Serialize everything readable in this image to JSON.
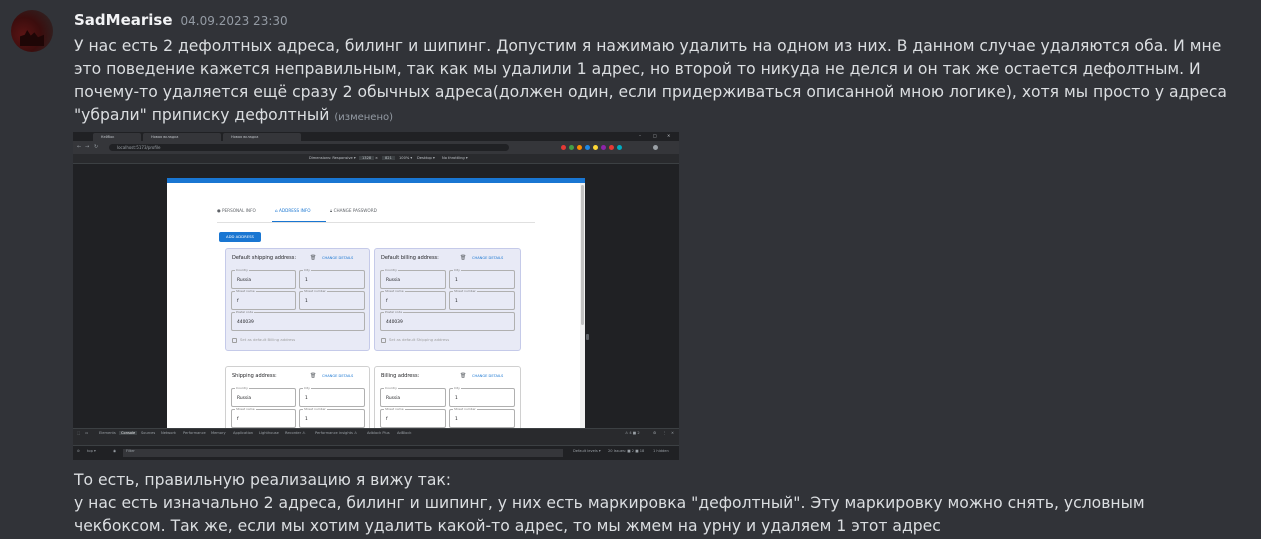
{
  "author": {
    "username": "SadMearise",
    "timestamp": "04.09.2023 23:30"
  },
  "message1": {
    "text": "У нас есть 2 дефолтных адреса, билинг и шипинг. Допустим я нажимаю удалить на одном из них. В данном случае удаляются оба. И мне это поведение кажется неправильным, так как мы удалили 1 адрес, но второй то никуда не делся и он так же остается дефолтным. И почему-то удаляется ещё сразу 2 обычных адреса(должен один, если придерживаться описанной мною логике), хотя мы просто у адреса \"убрали\" приписку дефолтный",
    "edited": "(изменено)"
  },
  "message2": {
    "line1": "То есть, правильную реализацию я вижу так:",
    "line2": "у нас есть изначально 2 адреса, билинг и шипинг, у них есть маркировка \"дефолтный\". Эту маркировку можно снять, условным чекбоксом. Так же, если мы хотим удалить какой-то адрес, то мы жмем на урну и удаляем 1 этот адрес"
  },
  "screenshot": {
    "browser": {
      "tabs": [
        "Кейбок",
        "Новая вкладка",
        "Новая вкладка"
      ],
      "window_controls": [
        "–",
        "□",
        "✕"
      ],
      "url": "localhost:5173/profile",
      "device_toolbar": {
        "dimensions": "Dimensions: Responsive ▾",
        "width": "1328",
        "x": "×",
        "height": "821",
        "zoom": "100% ▾",
        "device": "Desktop ▾",
        "throttle": "No throttling ▾"
      }
    },
    "profile_tabs": {
      "personal": "PERSONAL INFO",
      "address": "ADDRESS INFO",
      "password": "CHANGE PASSWORD"
    },
    "add_address_button": "ADD ADDRESS",
    "labels": {
      "country": "Country",
      "city": "City",
      "street_name": "Street name",
      "street_number": "Street number",
      "postal_code": "Postal code",
      "change_details": "CHANGE DETAILS"
    },
    "cards": {
      "default_shipping": {
        "title": "Default shipping address:",
        "country": "Russia",
        "city": "1",
        "street_name": "f",
        "street_number": "1",
        "postal_code": "440039",
        "checkbox": "Set as default Billing address"
      },
      "default_billing": {
        "title": "Default billing address:",
        "country": "Russia",
        "city": "1",
        "street_name": "f",
        "street_number": "1",
        "postal_code": "440039",
        "checkbox": "Set as default Shipping address"
      },
      "shipping": {
        "title": "Shipping address:",
        "country": "Russia",
        "city": "1",
        "street_name": "f",
        "street_number": "1"
      },
      "billing": {
        "title": "Billing address:",
        "country": "Russia",
        "city": "1",
        "street_name": "f",
        "street_number": "1"
      }
    },
    "devtools_tabs": [
      "Elements",
      "Console",
      "Sources",
      "Network",
      "Performance",
      "Memory",
      "Application",
      "Lighthouse",
      "Recorder ⚠",
      "Performance insights ⚠",
      "Adblock Plus",
      "AdBlock"
    ],
    "devtools_counts": "⚠ 4  ■ 2",
    "console_filter": {
      "context": "top ▾",
      "placeholder": "Filter",
      "levels": "Default levels ▾",
      "issues": "20 Issues: ■ 2 ■ 18",
      "hidden": "1 hidden"
    }
  }
}
